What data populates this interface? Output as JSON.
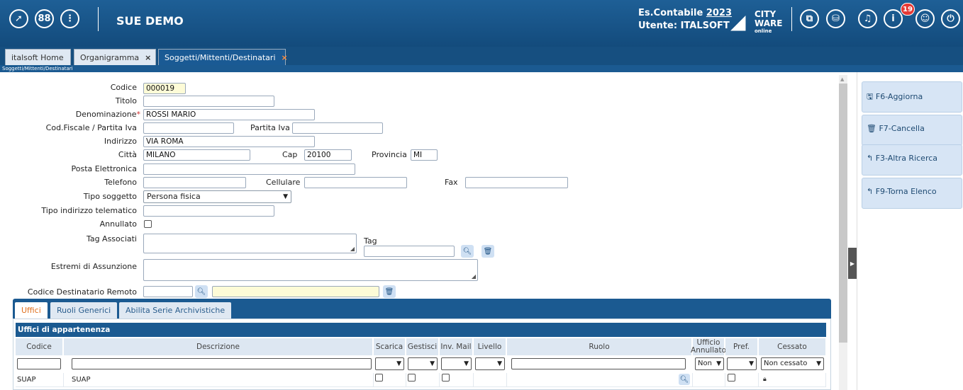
{
  "header": {
    "app_title": "SUE DEMO",
    "es_label": "Es.Contabile",
    "es_year": "2023",
    "user_line": "Utente: ITALSOFT",
    "logo_line1": "CITY",
    "logo_line2": "WARE",
    "logo_line3": "online",
    "notifications": "19",
    "left_icons": [
      "rocket-icon",
      "grid-icon",
      "more-vertical-icon"
    ],
    "right_icons": [
      "switch-window-icon",
      "database-icon",
      "headset-icon",
      "info-icon",
      "user-icon",
      "power-icon"
    ]
  },
  "tabs": [
    {
      "label": "italsoft Home"
    },
    {
      "label": "Organigramma",
      "close": "×"
    },
    {
      "label": "Soggetti/Mittenti/Destinatari",
      "close": "×"
    }
  ],
  "breadcrumb": "Soggetti/Mittenti/Destinatari",
  "form": {
    "codice": {
      "label": "Codice",
      "value": "000019"
    },
    "titolo": {
      "label": "Titolo",
      "value": ""
    },
    "denominazione": {
      "label": "Denominazione",
      "required": "*",
      "value": "ROSSI MARIO"
    },
    "codfiscale": {
      "label": "Cod.Fiscale / Partita Iva",
      "value": ""
    },
    "partitaiva": {
      "label": "Partita Iva",
      "value": ""
    },
    "indirizzo": {
      "label": "Indirizzo",
      "value": "VIA ROMA"
    },
    "citta": {
      "label": "Città",
      "value": "MILANO"
    },
    "cap": {
      "label": "Cap",
      "value": "20100"
    },
    "provincia": {
      "label": "Provincia",
      "value": "MI"
    },
    "pec": {
      "label": "Posta Elettronica",
      "value": ""
    },
    "telefono": {
      "label": "Telefono",
      "value": ""
    },
    "cellulare": {
      "label": "Cellulare",
      "value": ""
    },
    "fax": {
      "label": "Fax",
      "value": ""
    },
    "tipo_soggetto": {
      "label": "Tipo soggetto",
      "value": "Persona fisica"
    },
    "tipo_indirizzo": {
      "label": "Tipo indirizzo telematico",
      "value": ""
    },
    "annullato": {
      "label": "Annullato"
    },
    "tag_associati": {
      "label": "Tag Associati"
    },
    "tag": {
      "label": "Tag",
      "value": ""
    },
    "estremi": {
      "label": "Estremi di Assunzione"
    },
    "codice_remoto": {
      "label": "Codice Destinatario Remoto",
      "value": ""
    }
  },
  "actions": [
    {
      "label": "F6-Aggiorna",
      "icon": "save-icon",
      "glyph": "🖫"
    },
    {
      "label": "F7-Cancella",
      "icon": "trash-icon",
      "glyph": "🗑"
    },
    {
      "label": "F3-Altra Ricerca",
      "icon": "back-arrow-icon",
      "glyph": "↰"
    },
    {
      "label": "F9-Torna Elenco",
      "icon": "back-arrow-icon",
      "glyph": "↰"
    }
  ],
  "subtabs": [
    "Uffici",
    "Ruoli Generici",
    "Abilita Serie Archivistiche"
  ],
  "grid": {
    "title": "Uffici di appartenenza",
    "columns": [
      "Codice",
      "Descrizione",
      "Scarica",
      "Gestisci",
      "Inv. Mail",
      "Livello",
      "Ruolo",
      "Ufficio Annullato",
      "Pref.",
      "Cessato"
    ],
    "filters": {
      "annullato": "Non",
      "cessato": "Non cessato"
    },
    "rows": [
      {
        "codice": "SUAP",
        "descrizione": "SUAP"
      }
    ]
  },
  "colors": {
    "primary": "#1b5a91",
    "accent": "#e0701e",
    "highlight": "#fdfbd7",
    "button": "#d7e5f5"
  }
}
